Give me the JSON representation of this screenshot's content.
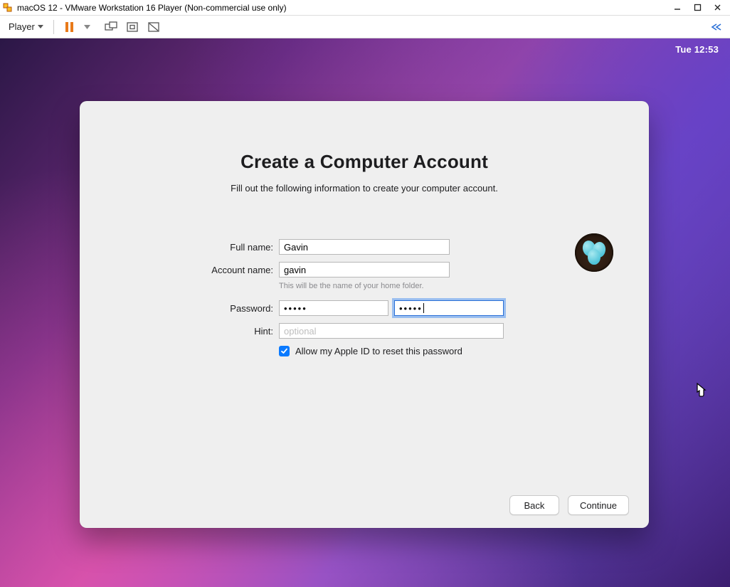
{
  "host": {
    "title": "macOS 12 - VMware Workstation 16 Player (Non-commercial use only)",
    "player_menu_label": "Player"
  },
  "macos": {
    "clock": "Tue 12:53"
  },
  "dialog": {
    "title": "Create a Computer Account",
    "subtitle": "Fill out the following information to create your computer account.",
    "labels": {
      "full_name": "Full name:",
      "account_name": "Account name:",
      "password": "Password:",
      "hint": "Hint:"
    },
    "values": {
      "full_name": "Gavin",
      "account_name": "gavin",
      "password_mask": "•••••",
      "verify_mask": "•••••",
      "hint": ""
    },
    "helpers": {
      "account_name_helper": "This will be the name of your home folder.",
      "hint_placeholder": "optional"
    },
    "checkbox": {
      "checked": true,
      "label": "Allow my Apple ID to reset this password"
    },
    "buttons": {
      "back": "Back",
      "continue": "Continue"
    },
    "avatar_name": "nest-eggs"
  }
}
